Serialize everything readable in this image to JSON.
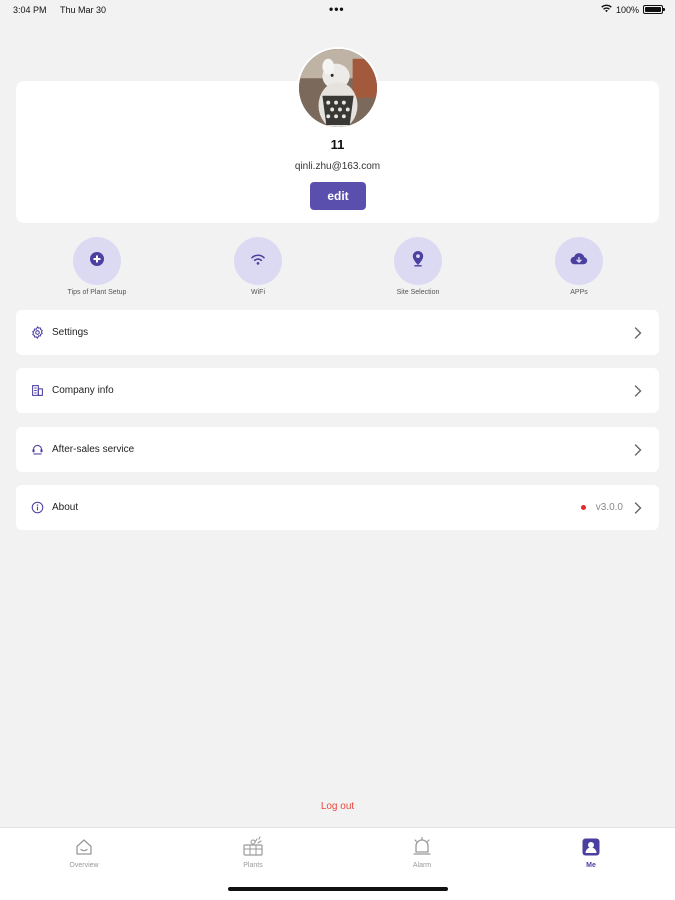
{
  "status_bar": {
    "time": "3:04 PM",
    "date": "Thu Mar 30",
    "dots": "•••",
    "battery": "100%"
  },
  "profile": {
    "name": "11",
    "email": "qinli.zhu@163.com",
    "edit_label": "edit"
  },
  "shortcuts": [
    {
      "label": "Tips of Plant Setup",
      "icon": "plus-circle-icon"
    },
    {
      "label": "WiFi",
      "icon": "wifi-icon"
    },
    {
      "label": "Site Selection",
      "icon": "location-pin-icon"
    },
    {
      "label": "APPs",
      "icon": "cloud-download-icon"
    }
  ],
  "menu": [
    {
      "label": "Settings",
      "icon": "gear-icon"
    },
    {
      "label": "Company info",
      "icon": "building-icon"
    },
    {
      "label": "After-sales service",
      "icon": "support-agent-icon"
    },
    {
      "label": "About",
      "icon": "info-icon",
      "version": "v3.0.0"
    }
  ],
  "logout_label": "Log out",
  "tabs": [
    {
      "label": "Overview",
      "icon": "home-icon",
      "active": false
    },
    {
      "label": "Plants",
      "icon": "plant-icon",
      "active": false
    },
    {
      "label": "Alarm",
      "icon": "alarm-bell-icon",
      "active": false
    },
    {
      "label": "Me",
      "icon": "user-icon",
      "active": true
    }
  ],
  "colors": {
    "accent": "#5b4fad",
    "shortcut_bg": "#dcdaf3",
    "logout": "#e5483c",
    "badge_dot": "#e5292b",
    "background": "#f2f2f3"
  }
}
